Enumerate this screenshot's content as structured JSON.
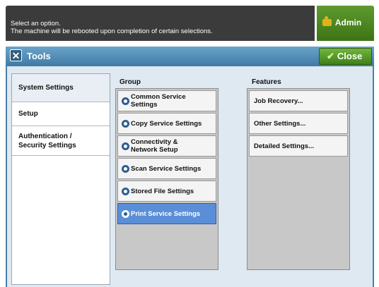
{
  "message": {
    "line1": "Select an option.",
    "line2": "The machine will be rebooted upon completion of certain selections."
  },
  "admin_label": "Admin",
  "title": "Tools",
  "close_label": "Close",
  "nav": [
    {
      "line1": "System Settings",
      "line2": ""
    },
    {
      "line1": "Setup",
      "line2": ""
    },
    {
      "line1": "Authentication /",
      "line2": "Security Settings"
    }
  ],
  "group": {
    "heading": "Group",
    "items": [
      {
        "line1": "Common Service",
        "line2": "Settings"
      },
      {
        "line1": "Copy Service Settings",
        "line2": ""
      },
      {
        "line1": "Connectivity &",
        "line2": "Network Setup"
      },
      {
        "line1": "Scan Service Settings",
        "line2": ""
      },
      {
        "line1": "Stored File Settings",
        "line2": ""
      },
      {
        "line1": "Print Service Settings",
        "line2": ""
      }
    ]
  },
  "features": {
    "heading": "Features",
    "items": [
      "Job Recovery...",
      "Other Settings...",
      "Detailed Settings..."
    ]
  }
}
